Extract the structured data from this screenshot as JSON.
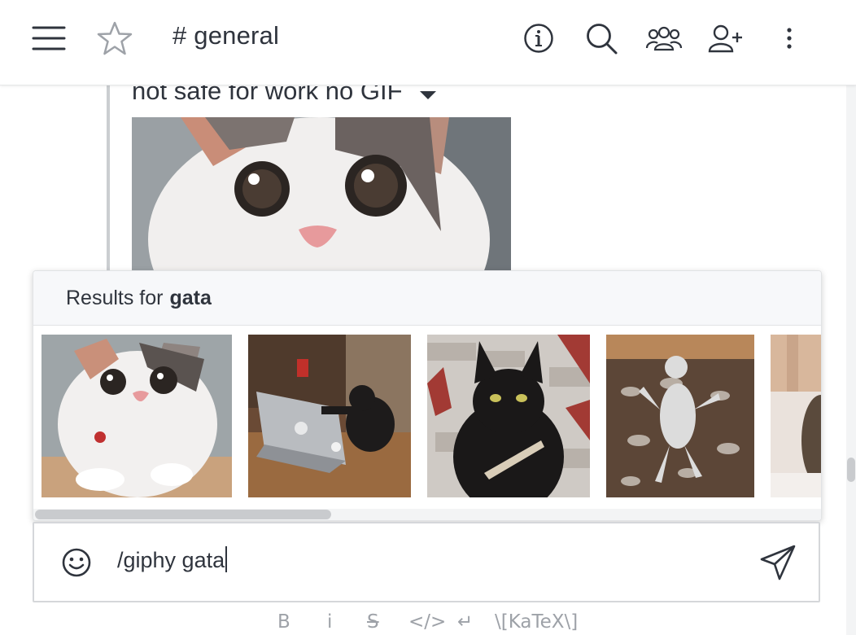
{
  "header": {
    "channel_title": "# general",
    "icons": [
      "menu-icon",
      "star-icon",
      "info-icon",
      "search-icon",
      "members-icon",
      "add-user-icon",
      "kebab-icon"
    ]
  },
  "message": {
    "attachment_title": "not safe for work no GIF"
  },
  "giphy_popup": {
    "results_prefix": "Results for",
    "query": "gata",
    "results": [
      {
        "name": "cat-surprised-gif"
      },
      {
        "name": "cat-laptop-gif"
      },
      {
        "name": "black-cat-knife-gif"
      },
      {
        "name": "dancing-cat-gif"
      },
      {
        "name": "cat-partial-gif"
      }
    ]
  },
  "composer": {
    "value": "/giphy gata"
  },
  "formatting": {
    "bold": "B",
    "italic": "i",
    "strike": "S",
    "code": "</>",
    "multiline": "↵",
    "katex": "\\[KaTeX\\]"
  },
  "colors": {
    "text": "#2f343d",
    "icon": "#2f343d",
    "muted": "#9ea2a8",
    "border": "#d5d7da"
  }
}
